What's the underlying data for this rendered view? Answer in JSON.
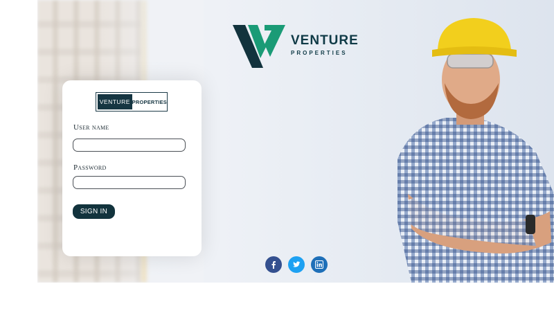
{
  "brand": {
    "title": "VENTURE",
    "subtitle": "PROPERTIES",
    "primary_color": "#0f3a46",
    "accent_color": "#1a9b76"
  },
  "login": {
    "logo_left": "VENTURE",
    "logo_right": "PROPERTIES",
    "username_label": "User name",
    "username_value": "",
    "password_label": "Password",
    "password_value": "",
    "sign_in_label": "SIGN IN",
    "button_color": "#12333d"
  },
  "social": [
    {
      "name": "facebook",
      "icon": "facebook-icon",
      "color": "#34508f"
    },
    {
      "name": "twitter",
      "icon": "twitter-icon",
      "color": "#1da1f2"
    },
    {
      "name": "linkedin",
      "icon": "linkedin-icon",
      "color": "#1e6fb8"
    }
  ]
}
